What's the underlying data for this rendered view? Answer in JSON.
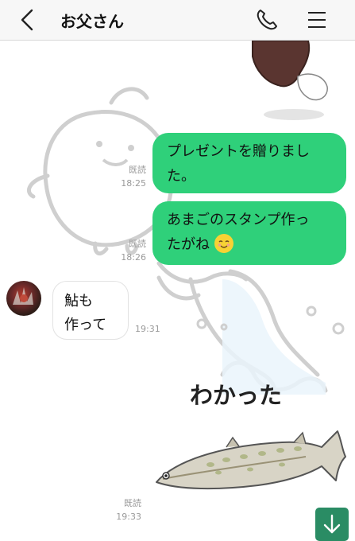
{
  "header": {
    "title": "お父さん",
    "back_icon": "chevron-left-icon",
    "call_icon": "phone-icon",
    "menu_icon": "hamburger-menu-icon"
  },
  "colors": {
    "outgoing_bubble": "#2fd07a",
    "incoming_bubble": "#ffffff",
    "header_bg": "#f7f7f7",
    "scroll_button": "#2a8c64"
  },
  "messages": [
    {
      "direction": "out",
      "text_lines": [
        "プレゼントを贈りまし",
        "た。"
      ],
      "read": "既読",
      "time": "18:25"
    },
    {
      "direction": "out",
      "text_lines": [
        "あまごのスタンプ作っ",
        "たがね"
      ],
      "emoji": "relieved-face-emoji",
      "read": "既読",
      "time": "18:26"
    },
    {
      "direction": "in",
      "text_lines": [
        "鮎も",
        "作って"
      ],
      "time": "19:31"
    },
    {
      "direction": "out",
      "type": "sticker",
      "sticker_text": "わかった",
      "sticker": "fish-sticker",
      "read": "既読",
      "time": "19:33"
    }
  ],
  "scroll_button_icon": "arrow-down-icon"
}
